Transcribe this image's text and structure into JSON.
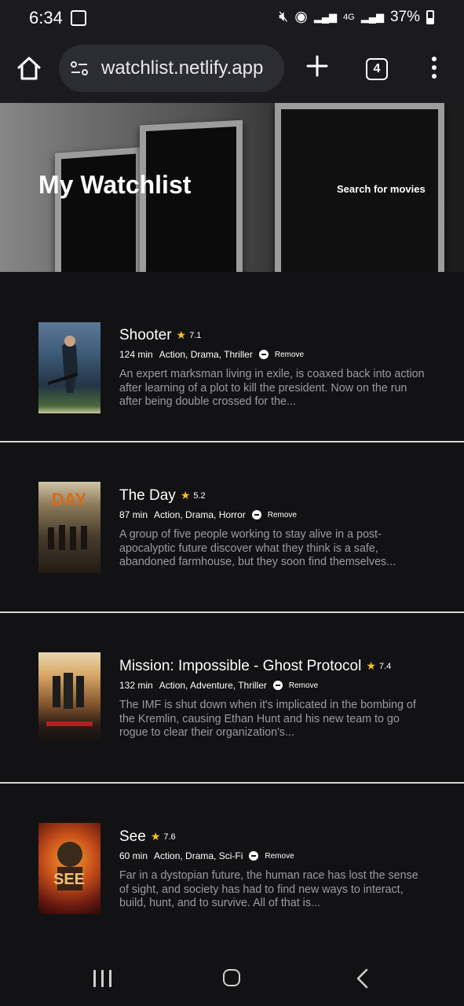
{
  "status_bar": {
    "time": "6:34",
    "network": "4G",
    "battery": "37%",
    "icons": [
      "gallery-icon",
      "mute-icon",
      "hotspot-icon",
      "signal-icon",
      "signal-icon",
      "battery-icon"
    ]
  },
  "browser": {
    "url": "watchlist.netlify.app",
    "tab_count": "4"
  },
  "hero": {
    "title": "My Watchlist",
    "search_link": "Search for movies"
  },
  "movies": [
    {
      "title": "Shooter",
      "rating": "7.1",
      "runtime": "124 min",
      "genres": "Action, Drama, Thriller",
      "remove_label": "Remove",
      "description": "An expert marksman living in exile, is coaxed back into action after learning of a plot to kill the president. Now on the run after being double crossed for the..."
    },
    {
      "title": "The Day",
      "rating": "5.2",
      "runtime": "87 min",
      "genres": "Action, Drama, Horror",
      "remove_label": "Remove",
      "description": "A group of five people working to stay alive in a post-apocalyptic future discover what they think is a safe, abandoned farmhouse, but they soon find themselves..."
    },
    {
      "title": "Mission: Impossible - Ghost Protocol",
      "rating": "7.4",
      "runtime": "132 min",
      "genres": "Action, Adventure, Thriller",
      "remove_label": "Remove",
      "description": "The IMF is shut down when it's implicated in the bombing of the Kremlin, causing Ethan Hunt and his new team to go rogue to clear their organization's..."
    },
    {
      "title": "See",
      "rating": "7.6",
      "runtime": "60 min",
      "genres": "Action, Drama, Sci-Fi",
      "remove_label": "Remove",
      "description": "Far in a dystopian future, the human race has lost the sense of sight, and society has had to find new ways to interact, build, hunt, and to survive. All of that is..."
    }
  ],
  "colors": {
    "background": "#121214",
    "star": "#f5c518",
    "description_text": "#9b9ba1",
    "divider": "#d6d6d6"
  }
}
